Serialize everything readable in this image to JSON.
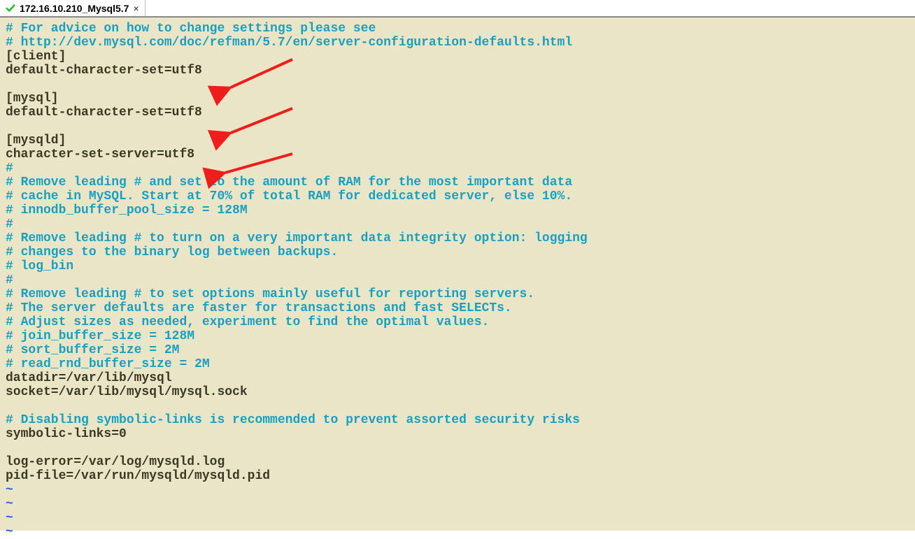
{
  "tab": {
    "label": "172.16.10.210_Mysql5.7",
    "close_glyph": "×"
  },
  "lines": [
    {
      "cls": "c",
      "text": "# For advice on how to change settings please see"
    },
    {
      "cls": "c",
      "text": "# http://dev.mysql.com/doc/refman/5.7/en/server-configuration-defaults.html"
    },
    {
      "cls": "t",
      "text": "[client]"
    },
    {
      "cls": "t",
      "text": "default-character-set=utf8"
    },
    {
      "cls": "t",
      "text": ""
    },
    {
      "cls": "t",
      "text": "[mysql]"
    },
    {
      "cls": "t",
      "text": "default-character-set=utf8"
    },
    {
      "cls": "t",
      "text": ""
    },
    {
      "cls": "t",
      "text": "[mysqld]"
    },
    {
      "cls": "t",
      "text": "character-set-server=utf8"
    },
    {
      "cls": "c",
      "text": "#"
    },
    {
      "cls": "c",
      "text": "# Remove leading # and set to the amount of RAM for the most important data"
    },
    {
      "cls": "c",
      "text": "# cache in MySQL. Start at 70% of total RAM for dedicated server, else 10%."
    },
    {
      "cls": "c",
      "text": "# innodb_buffer_pool_size = 128M"
    },
    {
      "cls": "c",
      "text": "#"
    },
    {
      "cls": "c",
      "text": "# Remove leading # to turn on a very important data integrity option: logging"
    },
    {
      "cls": "c",
      "text": "# changes to the binary log between backups."
    },
    {
      "cls": "c",
      "text": "# log_bin"
    },
    {
      "cls": "c",
      "text": "#"
    },
    {
      "cls": "c",
      "text": "# Remove leading # to set options mainly useful for reporting servers."
    },
    {
      "cls": "c",
      "text": "# The server defaults are faster for transactions and fast SELECTs."
    },
    {
      "cls": "c",
      "text": "# Adjust sizes as needed, experiment to find the optimal values."
    },
    {
      "cls": "c",
      "text": "# join_buffer_size = 128M"
    },
    {
      "cls": "c",
      "text": "# sort_buffer_size = 2M"
    },
    {
      "cls": "c",
      "text": "# read_rnd_buffer_size = 2M"
    },
    {
      "cls": "t",
      "text": "datadir=/var/lib/mysql"
    },
    {
      "cls": "t",
      "text": "socket=/var/lib/mysql/mysql.sock"
    },
    {
      "cls": "t",
      "text": ""
    },
    {
      "cls": "c",
      "text": "# Disabling symbolic-links is recommended to prevent assorted security risks"
    },
    {
      "cls": "t",
      "text": "symbolic-links=0"
    },
    {
      "cls": "t",
      "text": ""
    },
    {
      "cls": "t",
      "text": "log-error=/var/log/mysqld.log"
    },
    {
      "cls": "t",
      "text": "pid-file=/var/run/mysqld/mysqld.pid"
    },
    {
      "cls": "tilde",
      "text": "~"
    },
    {
      "cls": "tilde",
      "text": "~"
    },
    {
      "cls": "tilde",
      "text": "~"
    },
    {
      "cls": "tilde",
      "text": "~"
    }
  ],
  "annotation_color": "#f01d1d"
}
